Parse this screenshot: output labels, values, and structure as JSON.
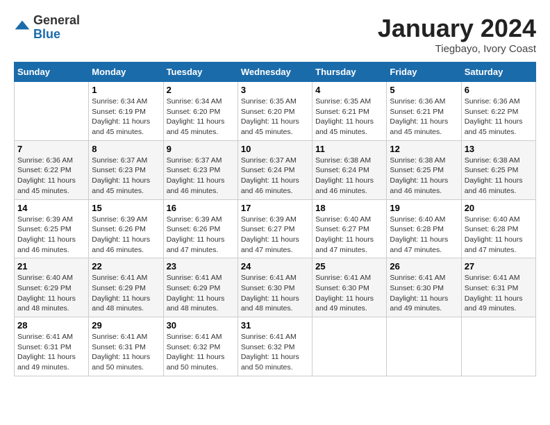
{
  "logo": {
    "general": "General",
    "blue": "Blue"
  },
  "title": "January 2024",
  "location": "Tiegbayo, Ivory Coast",
  "days_of_week": [
    "Sunday",
    "Monday",
    "Tuesday",
    "Wednesday",
    "Thursday",
    "Friday",
    "Saturday"
  ],
  "weeks": [
    [
      {
        "day": "",
        "info": ""
      },
      {
        "day": "1",
        "info": "Sunrise: 6:34 AM\nSunset: 6:19 PM\nDaylight: 11 hours and 45 minutes."
      },
      {
        "day": "2",
        "info": "Sunrise: 6:34 AM\nSunset: 6:20 PM\nDaylight: 11 hours and 45 minutes."
      },
      {
        "day": "3",
        "info": "Sunrise: 6:35 AM\nSunset: 6:20 PM\nDaylight: 11 hours and 45 minutes."
      },
      {
        "day": "4",
        "info": "Sunrise: 6:35 AM\nSunset: 6:21 PM\nDaylight: 11 hours and 45 minutes."
      },
      {
        "day": "5",
        "info": "Sunrise: 6:36 AM\nSunset: 6:21 PM\nDaylight: 11 hours and 45 minutes."
      },
      {
        "day": "6",
        "info": "Sunrise: 6:36 AM\nSunset: 6:22 PM\nDaylight: 11 hours and 45 minutes."
      }
    ],
    [
      {
        "day": "7",
        "info": "Sunrise: 6:36 AM\nSunset: 6:22 PM\nDaylight: 11 hours and 45 minutes."
      },
      {
        "day": "8",
        "info": "Sunrise: 6:37 AM\nSunset: 6:23 PM\nDaylight: 11 hours and 45 minutes."
      },
      {
        "day": "9",
        "info": "Sunrise: 6:37 AM\nSunset: 6:23 PM\nDaylight: 11 hours and 46 minutes."
      },
      {
        "day": "10",
        "info": "Sunrise: 6:37 AM\nSunset: 6:24 PM\nDaylight: 11 hours and 46 minutes."
      },
      {
        "day": "11",
        "info": "Sunrise: 6:38 AM\nSunset: 6:24 PM\nDaylight: 11 hours and 46 minutes."
      },
      {
        "day": "12",
        "info": "Sunrise: 6:38 AM\nSunset: 6:25 PM\nDaylight: 11 hours and 46 minutes."
      },
      {
        "day": "13",
        "info": "Sunrise: 6:38 AM\nSunset: 6:25 PM\nDaylight: 11 hours and 46 minutes."
      }
    ],
    [
      {
        "day": "14",
        "info": "Sunrise: 6:39 AM\nSunset: 6:25 PM\nDaylight: 11 hours and 46 minutes."
      },
      {
        "day": "15",
        "info": "Sunrise: 6:39 AM\nSunset: 6:26 PM\nDaylight: 11 hours and 46 minutes."
      },
      {
        "day": "16",
        "info": "Sunrise: 6:39 AM\nSunset: 6:26 PM\nDaylight: 11 hours and 47 minutes."
      },
      {
        "day": "17",
        "info": "Sunrise: 6:39 AM\nSunset: 6:27 PM\nDaylight: 11 hours and 47 minutes."
      },
      {
        "day": "18",
        "info": "Sunrise: 6:40 AM\nSunset: 6:27 PM\nDaylight: 11 hours and 47 minutes."
      },
      {
        "day": "19",
        "info": "Sunrise: 6:40 AM\nSunset: 6:28 PM\nDaylight: 11 hours and 47 minutes."
      },
      {
        "day": "20",
        "info": "Sunrise: 6:40 AM\nSunset: 6:28 PM\nDaylight: 11 hours and 47 minutes."
      }
    ],
    [
      {
        "day": "21",
        "info": "Sunrise: 6:40 AM\nSunset: 6:29 PM\nDaylight: 11 hours and 48 minutes."
      },
      {
        "day": "22",
        "info": "Sunrise: 6:41 AM\nSunset: 6:29 PM\nDaylight: 11 hours and 48 minutes."
      },
      {
        "day": "23",
        "info": "Sunrise: 6:41 AM\nSunset: 6:29 PM\nDaylight: 11 hours and 48 minutes."
      },
      {
        "day": "24",
        "info": "Sunrise: 6:41 AM\nSunset: 6:30 PM\nDaylight: 11 hours and 48 minutes."
      },
      {
        "day": "25",
        "info": "Sunrise: 6:41 AM\nSunset: 6:30 PM\nDaylight: 11 hours and 49 minutes."
      },
      {
        "day": "26",
        "info": "Sunrise: 6:41 AM\nSunset: 6:30 PM\nDaylight: 11 hours and 49 minutes."
      },
      {
        "day": "27",
        "info": "Sunrise: 6:41 AM\nSunset: 6:31 PM\nDaylight: 11 hours and 49 minutes."
      }
    ],
    [
      {
        "day": "28",
        "info": "Sunrise: 6:41 AM\nSunset: 6:31 PM\nDaylight: 11 hours and 49 minutes."
      },
      {
        "day": "29",
        "info": "Sunrise: 6:41 AM\nSunset: 6:31 PM\nDaylight: 11 hours and 50 minutes."
      },
      {
        "day": "30",
        "info": "Sunrise: 6:41 AM\nSunset: 6:32 PM\nDaylight: 11 hours and 50 minutes."
      },
      {
        "day": "31",
        "info": "Sunrise: 6:41 AM\nSunset: 6:32 PM\nDaylight: 11 hours and 50 minutes."
      },
      {
        "day": "",
        "info": ""
      },
      {
        "day": "",
        "info": ""
      },
      {
        "day": "",
        "info": ""
      }
    ]
  ]
}
